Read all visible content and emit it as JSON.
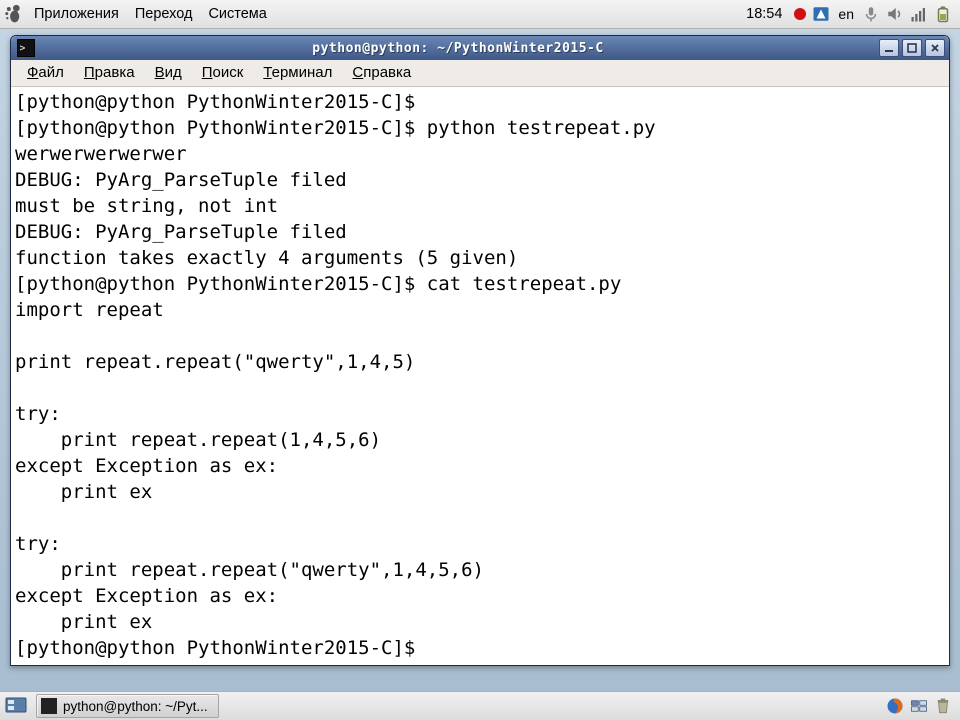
{
  "top_panel": {
    "menus": [
      "Приложения",
      "Переход",
      "Система"
    ],
    "clock": "18:54",
    "lang": "en"
  },
  "window": {
    "title": "python@python: ~/PythonWinter2015-C",
    "menubar": [
      {
        "label": "Файл",
        "ul": "Ф"
      },
      {
        "label": "Правка",
        "ul": "П"
      },
      {
        "label": "Вид",
        "ul": "В"
      },
      {
        "label": "Поиск",
        "ul": "П"
      },
      {
        "label": "Терминал",
        "ul": "Т"
      },
      {
        "label": "Справка",
        "ul": "С"
      }
    ],
    "terminal_lines": [
      "[python@python PythonWinter2015-C]$ ",
      "[python@python PythonWinter2015-C]$ python testrepeat.py",
      "werwerwerwerwer",
      "DEBUG: PyArg_ParseTuple filed",
      "must be string, not int",
      "DEBUG: PyArg_ParseTuple filed",
      "function takes exactly 4 arguments (5 given)",
      "[python@python PythonWinter2015-C]$ cat testrepeat.py",
      "import repeat",
      "",
      "print repeat.repeat(\"qwerty\",1,4,5)",
      "",
      "try:",
      "    print repeat.repeat(1,4,5,6)",
      "except Exception as ex:",
      "    print ex",
      "",
      "try:",
      "    print repeat.repeat(\"qwerty\",1,4,5,6)",
      "except Exception as ex:",
      "    print ex",
      "[python@python PythonWinter2015-C]$ "
    ]
  },
  "bottom_panel": {
    "task_label": "python@python: ~/Pyt..."
  }
}
